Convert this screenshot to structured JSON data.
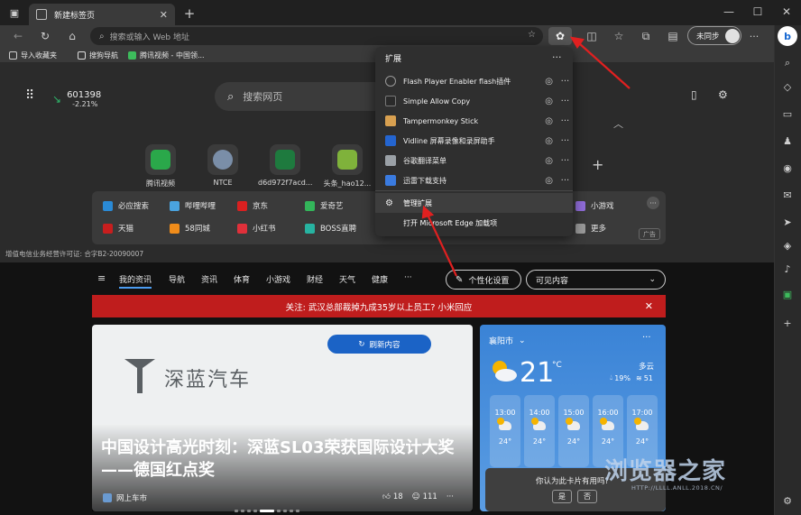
{
  "tab": {
    "title": "新建标签页"
  },
  "address": {
    "placeholder": "搜索或输入 Web 地址"
  },
  "profile": {
    "sync_label": "未同步"
  },
  "favorites": [
    {
      "label": "导入收藏夹",
      "icon": "import-icon",
      "color": "#cccccc"
    },
    {
      "label": "搜狗导航",
      "icon": "doc-icon",
      "color": "#e0e0e0"
    },
    {
      "label": "腾讯视频 - 中国领...",
      "icon": "tencent-video-icon",
      "color": "#3dbb5c"
    }
  ],
  "ntp": {
    "stock_value": "601398",
    "stock_change": "-2.21%",
    "search_placeholder": "搜索网页",
    "quick_links": [
      {
        "label": "腾讯视频",
        "color": "#2aa84a"
      },
      {
        "label": "NTCE",
        "color": "#7a8ea8"
      },
      {
        "label": "d6d972f7acd...",
        "color": "#1e7a3e"
      },
      {
        "label": "头条_hao12...",
        "color": "#7fb23b"
      }
    ],
    "sites_row1": [
      {
        "label": "必应搜索",
        "color": "#2a8ad6"
      },
      {
        "label": "哔哩哔哩",
        "color": "#4aa3df"
      },
      {
        "label": "京东",
        "color": "#d92020"
      },
      {
        "label": "爱奇艺",
        "color": "#33b55a"
      },
      {
        "label": "小游戏",
        "color": "#8f6cd8"
      }
    ],
    "sites_row2": [
      {
        "label": "天猫",
        "color": "#c81e1e"
      },
      {
        "label": "58同城",
        "color": "#f08c1a"
      },
      {
        "label": "小红书",
        "color": "#e0303a"
      },
      {
        "label": "BOSS直聘",
        "color": "#27b3a1"
      },
      {
        "label": "更多",
        "color": "#9a9a9a"
      }
    ],
    "ad_label": "广告",
    "icp": "增值电信业务经营许可证: 合字B2-20090007"
  },
  "news": {
    "nav": [
      "我的资讯",
      "导航",
      "资讯",
      "体育",
      "小游戏",
      "财经",
      "天气",
      "健康",
      "···"
    ],
    "personalize_label": "个性化设置",
    "visible_label": "可见内容",
    "notice": "关注: 武汉总部裁掉九成35岁以上员工? 小米回应",
    "refresh_label": "刷新内容",
    "logo_text": "深蓝汽车",
    "headline": "中国设计高光时刻：深蓝SL03荣获国际设计大奖——德国红点奖",
    "source": "网上车市",
    "likes": "18",
    "comments": "111"
  },
  "weather": {
    "city": "襄阳市",
    "temp": "21",
    "unit": "°C",
    "condition": "多云",
    "humidity": "19%",
    "wind": "51",
    "hours": [
      {
        "time": "13:00",
        "temp": "24°"
      },
      {
        "time": "14:00",
        "temp": "24°"
      },
      {
        "time": "15:00",
        "temp": "24°"
      },
      {
        "time": "16:00",
        "temp": "24°"
      },
      {
        "time": "17:00",
        "temp": "24°"
      }
    ]
  },
  "feedback": {
    "question": "你认为此卡片有用吗?",
    "yes": "是",
    "no": "否"
  },
  "watermark": {
    "text": "浏览器之家",
    "url": "HTTP://LLLL.ANLL.2018.CN/"
  },
  "extensions": {
    "title": "扩展",
    "items": [
      {
        "name": "Flash Player Enabler flash插件",
        "color": "#555555"
      },
      {
        "name": "Simple Allow Copy",
        "color": "#2a2a2a"
      },
      {
        "name": "Tampermonkey Stick",
        "color": "#d8a050"
      },
      {
        "name": "Vidline 屏幕录像和录屏助手",
        "color": "#2465d0"
      },
      {
        "name": "谷歌翻译菜单",
        "color": "#9aa0a6"
      },
      {
        "name": "迅雷下载支持",
        "color": "#3a7be0"
      }
    ],
    "manage_label": "管理扩展",
    "addons_label": "打开 Microsoft Edge 加载项"
  },
  "colors": {
    "accent_red": "#e02020",
    "notice_bg": "#bf1d1d",
    "refresh_bg": "#1b63c6"
  }
}
